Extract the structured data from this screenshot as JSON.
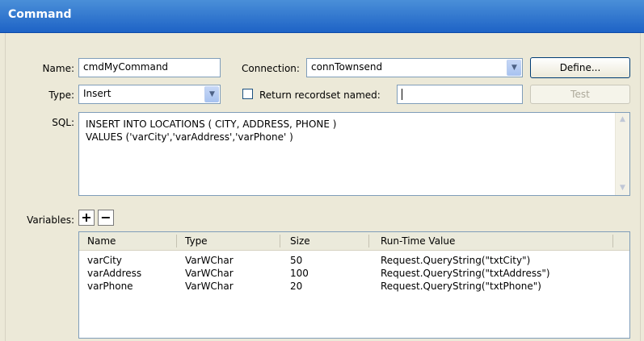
{
  "window": {
    "title": "Command"
  },
  "form": {
    "name_label": "Name:",
    "name_value": "cmdMyCommand",
    "connection_label": "Connection:",
    "connection_value": "connTownsend",
    "define_button": "Define...",
    "type_label": "Type:",
    "type_value": "Insert",
    "return_recordset_label": "Return recordset named:",
    "return_recordset_value": "",
    "test_button": "Test",
    "sql_label": "SQL:",
    "sql_line1": "INSERT INTO  LOCATIONS ( CITY, ADDRESS, PHONE )",
    "sql_line2": "VALUES ('varCity','varAddress','varPhone' )",
    "variables_label": "Variables:"
  },
  "variables_table": {
    "headers": [
      "Name",
      "Type",
      "Size",
      "Run-Time Value"
    ],
    "rows": [
      [
        "varCity",
        "VarWChar",
        "50",
        "Request.QueryString(\"txtCity\")"
      ],
      [
        "varAddress",
        "VarWChar",
        "100",
        "Request.QueryString(\"txtAddress\")"
      ],
      [
        "varPhone",
        "VarWChar",
        "20",
        "Request.QueryString(\"txtPhone\")"
      ]
    ]
  },
  "colors": {
    "title_bar": "#2a6ccd",
    "panel": "#ece9d8",
    "field_border": "#7f9db9"
  }
}
